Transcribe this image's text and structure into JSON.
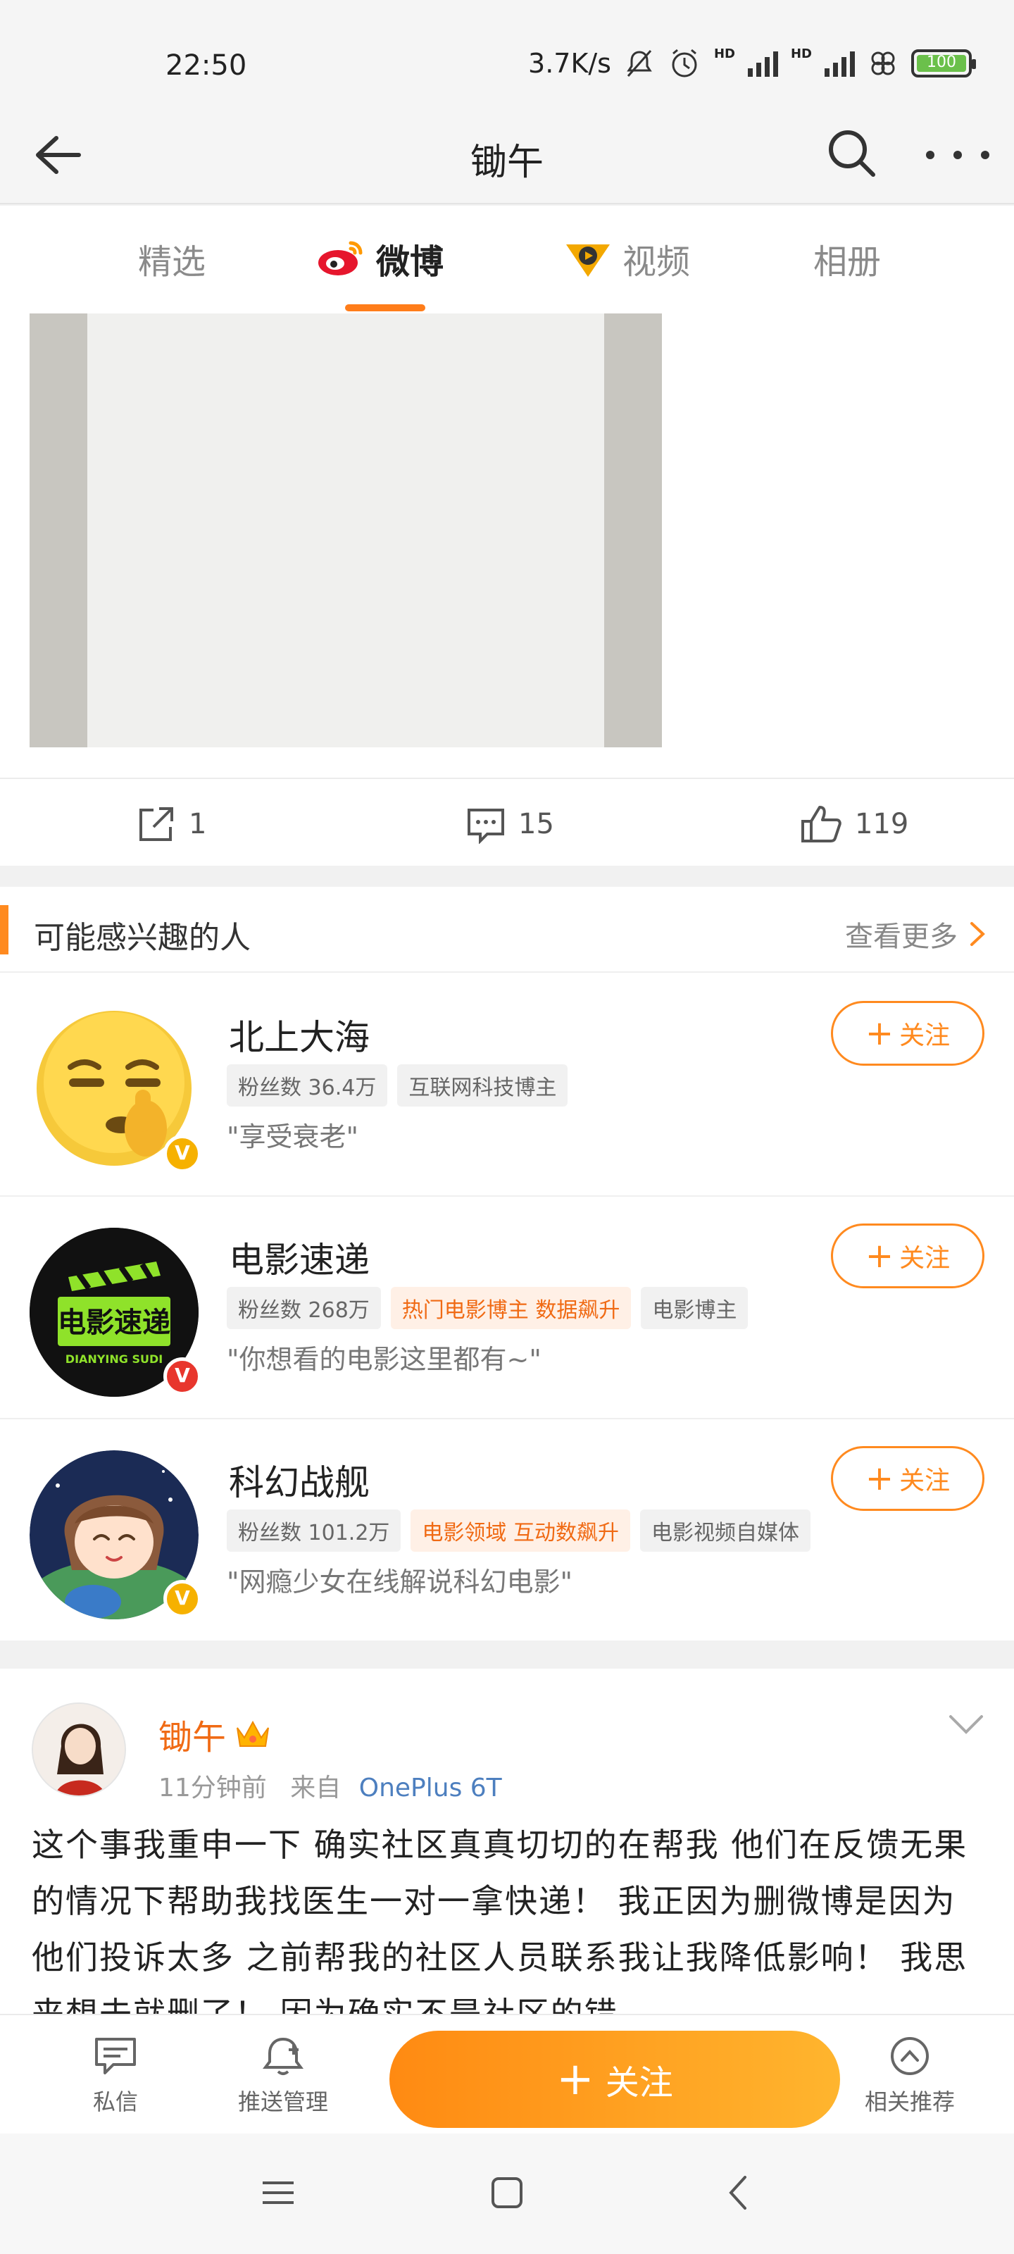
{
  "status_bar": {
    "time": "22:50",
    "net_speed": "3.7K/s",
    "battery_level": "100",
    "hd1": "HD",
    "hd2": "HD"
  },
  "nav": {
    "title": "锄午"
  },
  "tabs": [
    {
      "label": "精选",
      "active": false
    },
    {
      "label": "微博",
      "active": true
    },
    {
      "label": "视频",
      "active": false
    },
    {
      "label": "相册",
      "active": false
    }
  ],
  "post_actions": {
    "repost_count": "1",
    "comment_count": "15",
    "like_count": "119"
  },
  "recommend": {
    "title": "可能感兴趣的人",
    "more_label": "查看更多",
    "follow_label": "关注",
    "people": [
      {
        "name": "北上大海",
        "fans": "粉丝数 36.4万",
        "tags": [
          "互联网科技博主"
        ],
        "hot_tags": [],
        "desc": "\"享受衰老\"",
        "badge": "V"
      },
      {
        "name": "电影速递",
        "fans": "粉丝数 268万",
        "hot_tags": [
          "热门电影博主 数据飙升"
        ],
        "tags": [
          "电影博主"
        ],
        "desc": "\"你想看的电影这里都有~\"",
        "badge": "V",
        "logo_text": "电影速递",
        "logo_sub": "DIANYING SUDI"
      },
      {
        "name": "科幻战舰",
        "fans": "粉丝数 101.2万",
        "hot_tags": [
          "电影领域 互动数飙升"
        ],
        "tags": [
          "电影视频自媒体"
        ],
        "desc": "\"网瘾少女在线解说科幻电影\"",
        "badge": "V"
      }
    ]
  },
  "post": {
    "username": "锄午",
    "time": "11分钟前",
    "from_label": "来自",
    "device": "OnePlus 6T",
    "text": "这个事我重申一下 确实社区真真切切的在帮我 他们在反馈无果的情况下帮助我找医生一对一拿快递！ 我正因为删微博是因为他们投诉太多 之前帮我的社区人员联系我让我降低影响！ 我思来想去就删了！ 因为确实不是社区的错"
  },
  "bottom_bar": {
    "message_label": "私信",
    "push_label": "推送管理",
    "follow_label": "关注",
    "related_label": "相关推荐"
  },
  "colors": {
    "accent": "#ff8a1f",
    "hot_tag_text": "#f06a14",
    "link": "#4d7fbf"
  }
}
